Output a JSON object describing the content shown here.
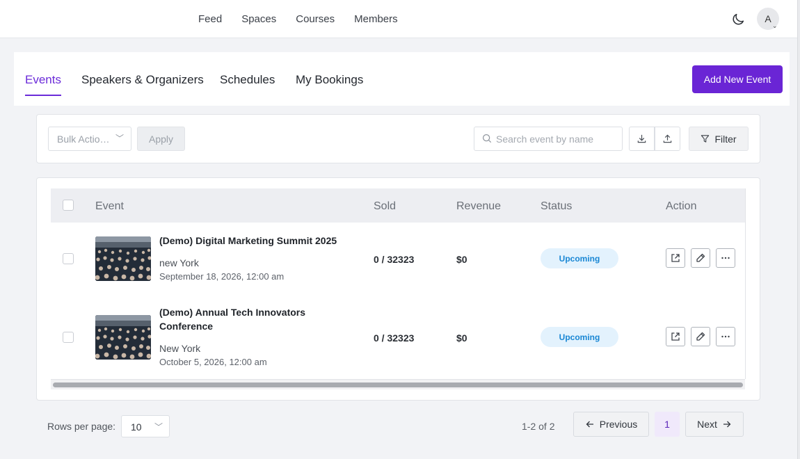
{
  "topnav": {
    "links": [
      "Feed",
      "Spaces",
      "Courses",
      "Members"
    ],
    "avatar_initial": "A"
  },
  "tabs": {
    "items": [
      "Events",
      "Speakers & Organizers",
      "Schedules",
      "My Bookings"
    ],
    "active": "Events",
    "add_button": "Add New Event"
  },
  "toolbar": {
    "bulk_action": "Bulk Actio…",
    "apply": "Apply",
    "search_placeholder": "Search event by name",
    "filter": "Filter"
  },
  "table": {
    "columns": [
      "Event",
      "Sold",
      "Revenue",
      "Status",
      "Action"
    ],
    "rows": [
      {
        "title": "(Demo) Digital Marketing Summit 2025",
        "location": "new York",
        "date": "September 18, 2026, 12:00 am",
        "sold": "0 / 32323",
        "revenue": "$0",
        "status": "Upcoming"
      },
      {
        "title": "(Demo) Annual Tech Innovators Conference",
        "location": "New York",
        "date": "October 5, 2026, 12:00 am",
        "sold": "0 / 32323",
        "revenue": "$0",
        "status": "Upcoming"
      }
    ]
  },
  "pagination": {
    "rows_per_page_label": "Rows per page:",
    "rows_per_page": "10",
    "range": "1-2 of 2",
    "previous": "Previous",
    "page": "1",
    "next": "Next"
  },
  "colors": {
    "accent": "#6a25d5",
    "status_bg": "#e3f2fd",
    "status_text": "#1886d4"
  }
}
